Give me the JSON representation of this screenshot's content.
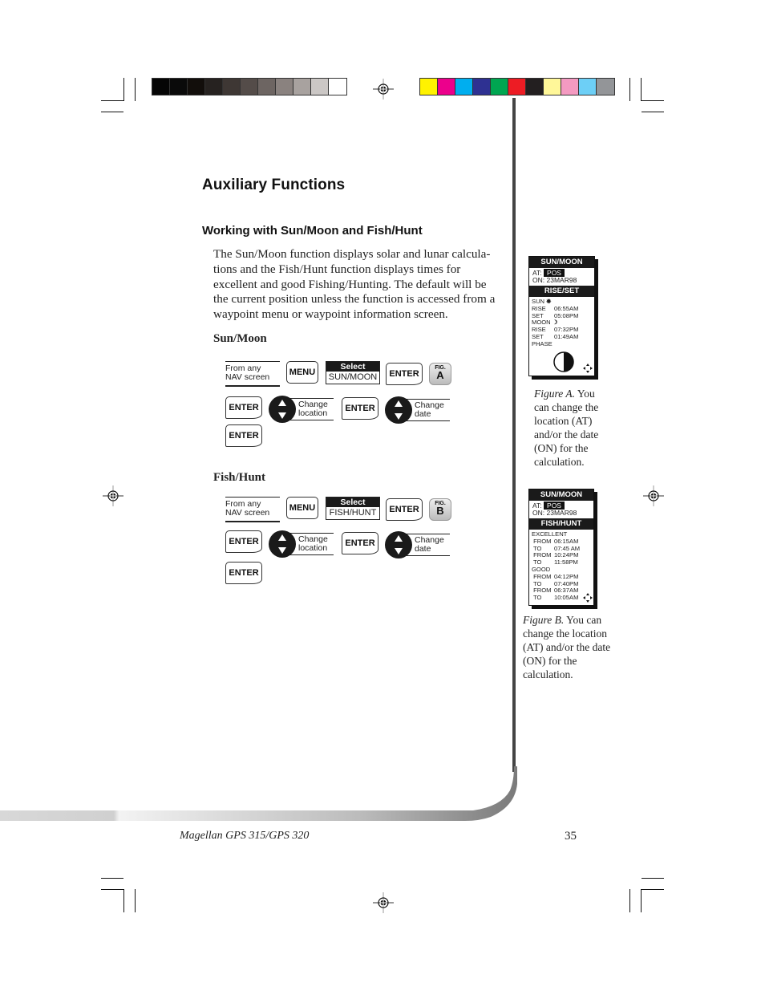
{
  "registration": {
    "gray_swatches": [
      "#050505",
      "#0a0a0a",
      "#120e0b",
      "#262220",
      "#3e3734",
      "#544c49",
      "#6d6562",
      "#8a827f",
      "#a8a29f",
      "#cbc7c5",
      "#ffffff"
    ],
    "color_swatches": [
      "#fff200",
      "#ec008c",
      "#00aeef",
      "#2e3192",
      "#00a651",
      "#ed1c24",
      "#231f20",
      "#fff799",
      "#f49ac1",
      "#6dcff6",
      "#939598"
    ]
  },
  "page": {
    "title": "Auxiliary Functions",
    "section_heading": "Working with Sun/Moon and Fish/Hunt",
    "body": "The Sun/Moon function displays solar and lunar calcula-tions and the Fish/Hunt function displays times for excellent and good Fishing/Hunting.  The default will be the current position unless the function is accessed from a waypoint menu or waypoint information screen."
  },
  "sun_moon_flow": {
    "heading": "Sun/Moon",
    "from_label": "From any NAV screen",
    "menu_key": "MENU",
    "select_title": "Select",
    "select_value": "SUN/MOON",
    "enter_key": "ENTER",
    "fig_label": "FIG.",
    "fig_letter": "A",
    "change_location": "Change location",
    "change_date": "Change date"
  },
  "fish_hunt_flow": {
    "heading": "Fish/Hunt",
    "from_label": "From any NAV screen",
    "menu_key": "MENU",
    "select_title": "Select",
    "select_value": "FISH/HUNT",
    "enter_key": "ENTER",
    "fig_label": "FIG.",
    "fig_letter": "B",
    "change_location": "Change location",
    "change_date": "Change date"
  },
  "figure_a": {
    "title": "SUN/MOON",
    "at_label": "AT:",
    "at_value": "POS",
    "on_label": "ON:",
    "on_value": "23MAR98",
    "section": "RISE/SET",
    "rows": [
      {
        "label": "SUN",
        "value": "",
        "icon": "sun-icon"
      },
      {
        "label": "RISE",
        "value": "06:55AM"
      },
      {
        "label": "SET",
        "value": "05:08PM"
      },
      {
        "label": "MOON",
        "value": "",
        "icon": "moon-icon"
      },
      {
        "label": "RISE",
        "value": "07:32PM"
      },
      {
        "label": "SET",
        "value": "01:49AM"
      },
      {
        "label": "PHASE",
        "value": ""
      }
    ],
    "moon_phase_illumination": 0.5,
    "caption_italic": "Figure A.",
    "caption_text": "You can change the location (AT) and/or the date (ON) for the calculation."
  },
  "figure_b": {
    "title": "SUN/MOON",
    "at_label": "AT:",
    "at_value": "POS",
    "on_label": "ON:",
    "on_value": "23MAR98",
    "section": "FISH/HUNT",
    "rows": [
      {
        "label": "EXCELLENT",
        "value": ""
      },
      {
        "label": " FROM",
        "value": "06:15AM"
      },
      {
        "label": " TO",
        "value": "07:45 AM"
      },
      {
        "label": " FROM",
        "value": "10:24PM"
      },
      {
        "label": " TO",
        "value": "11:58PM"
      },
      {
        "label": "GOOD",
        "value": ""
      },
      {
        "label": " FROM",
        "value": "04:12PM"
      },
      {
        "label": " TO",
        "value": "07:40PM"
      },
      {
        "label": " FROM",
        "value": "06:37AM"
      },
      {
        "label": " TO",
        "value": "10:05AM"
      }
    ],
    "caption_italic": "Figure B.",
    "caption_text": "You can change the location (AT) and/or the date (ON) for the calculation."
  },
  "footer": {
    "product": "Magellan GPS 315/GPS 320",
    "page_number": "35"
  }
}
